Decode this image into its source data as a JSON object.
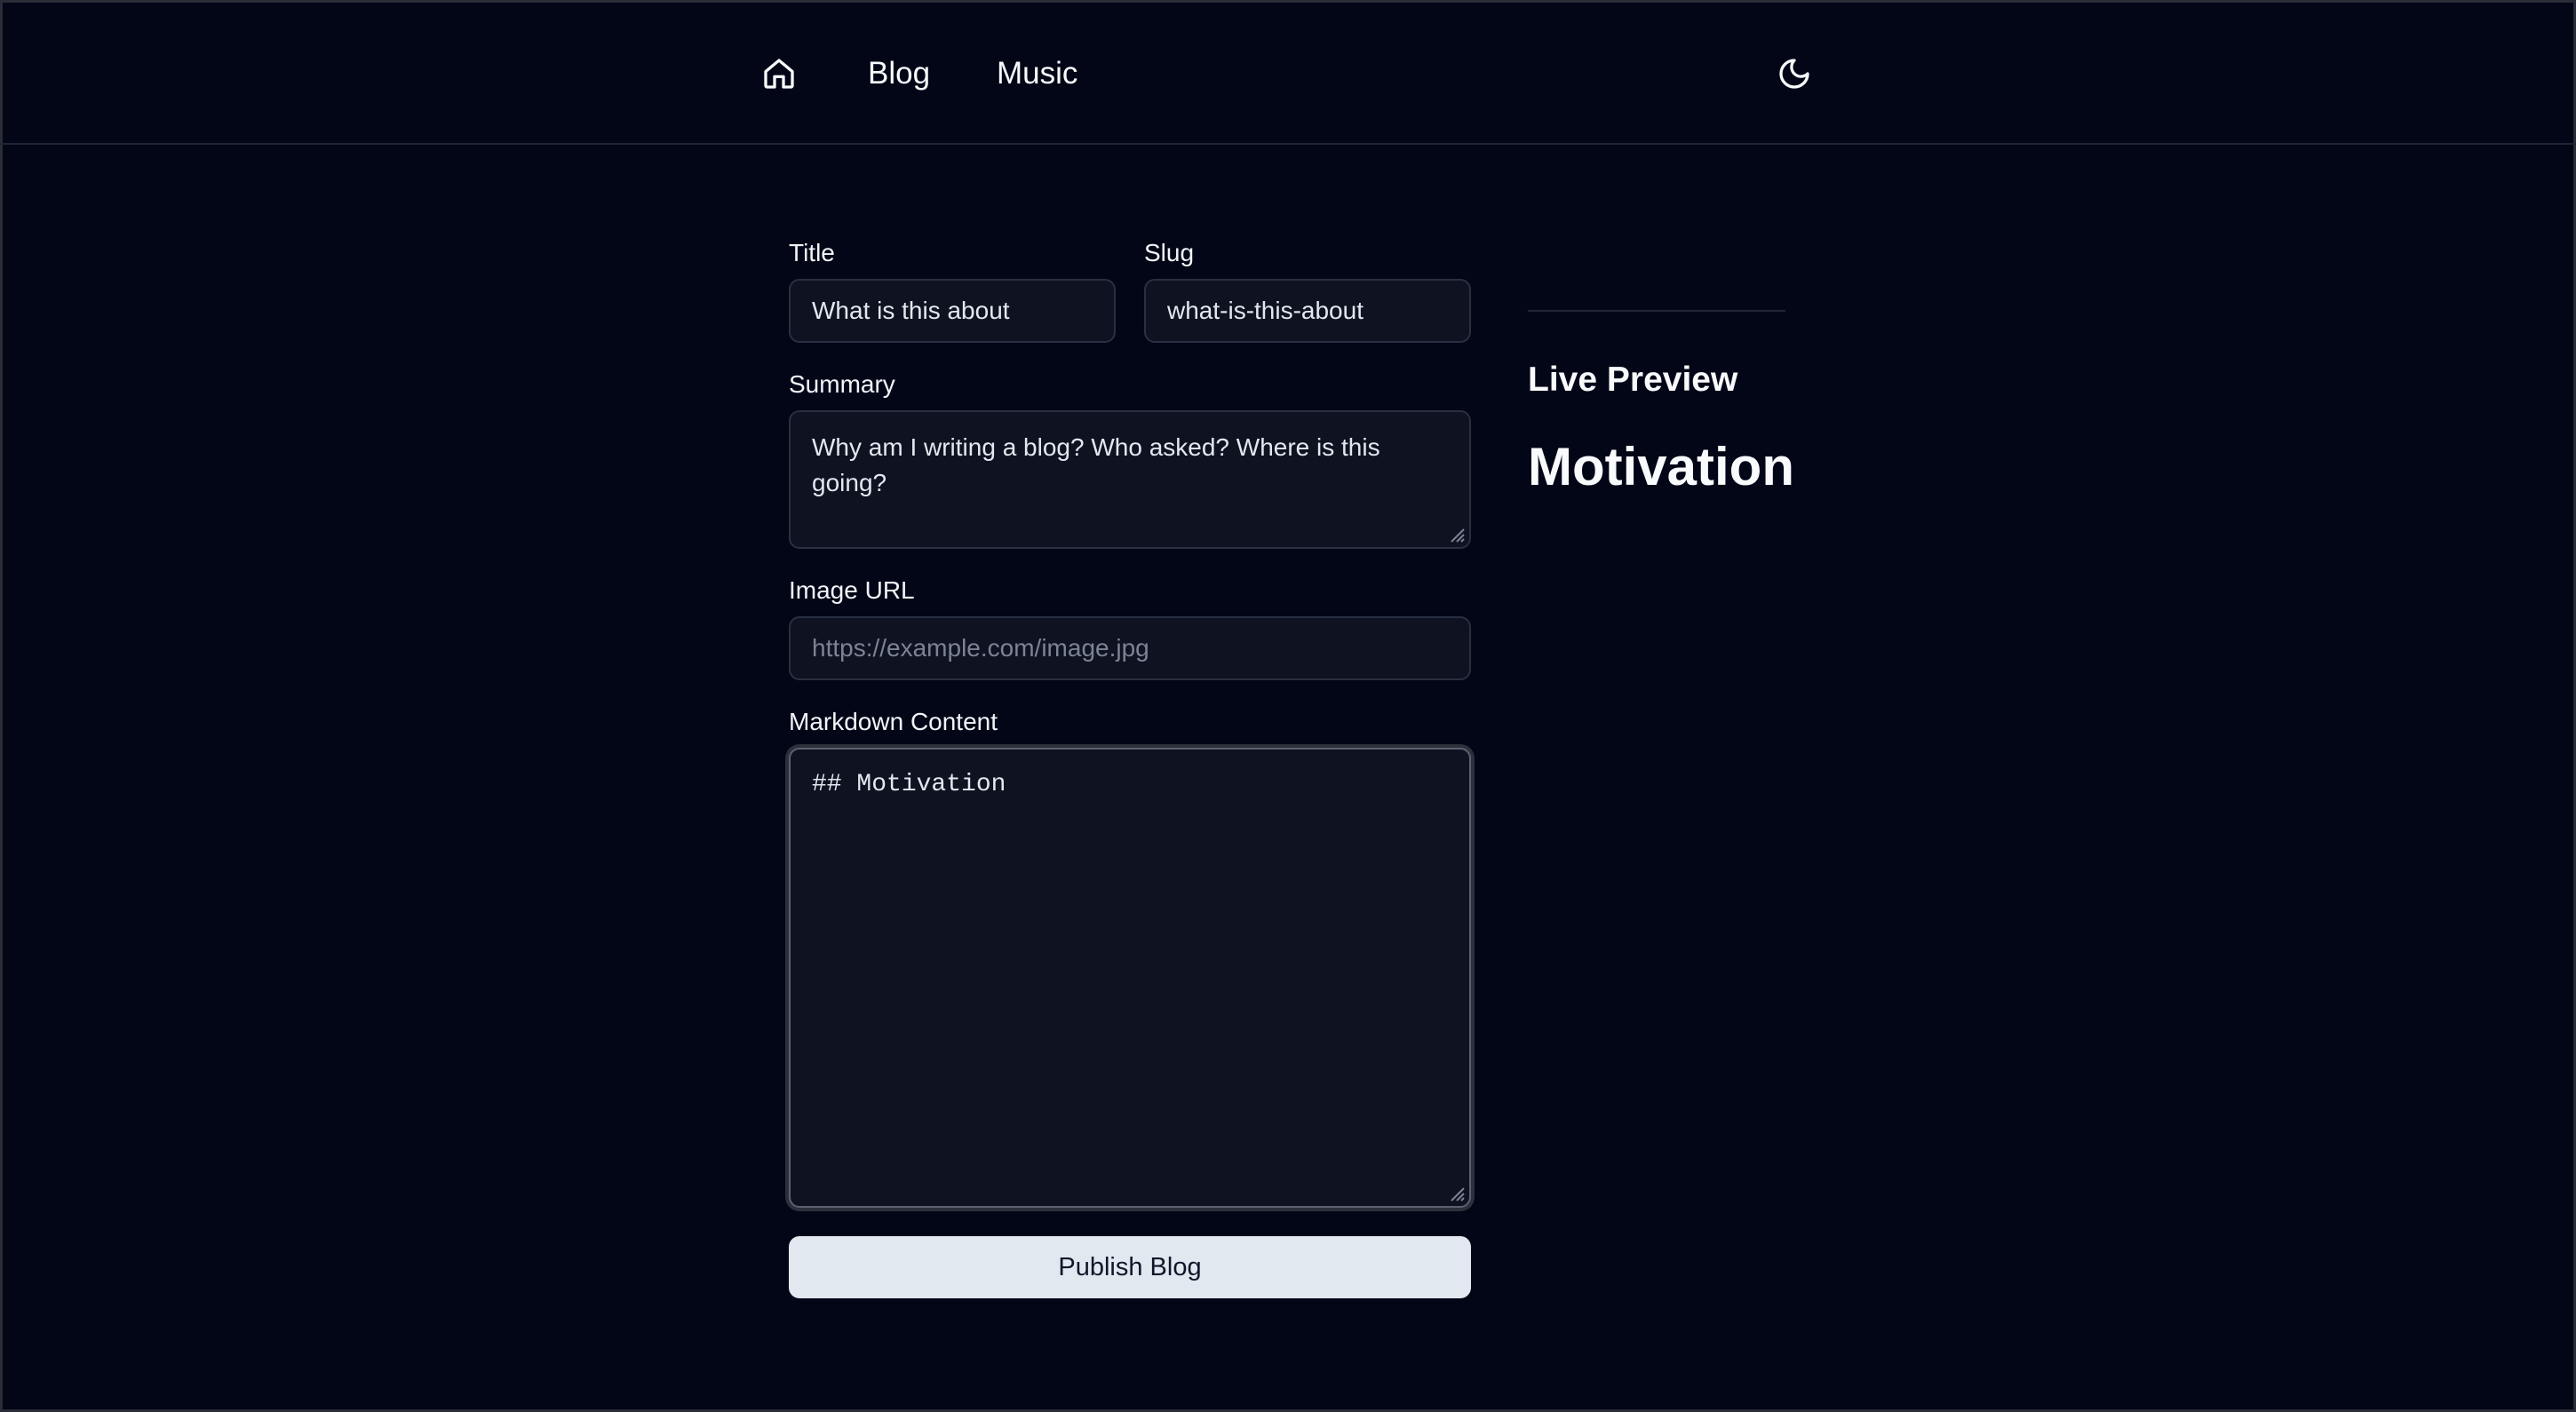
{
  "nav": {
    "home_icon": "home-icon",
    "blog_label": "Blog",
    "music_label": "Music",
    "theme_icon": "moon-icon"
  },
  "form": {
    "title": {
      "label": "Title",
      "value": "What is this about"
    },
    "slug": {
      "label": "Slug",
      "value": "what-is-this-about"
    },
    "summary": {
      "label": "Summary",
      "value": "Why am I writing a blog? Who asked? Where is this going?"
    },
    "image_url": {
      "label": "Image URL",
      "value": "",
      "placeholder": "https://example.com/image.jpg"
    },
    "markdown": {
      "label": "Markdown Content",
      "value": "## Motivation\n\n"
    },
    "publish_label": "Publish Blog"
  },
  "preview": {
    "heading": "Live Preview",
    "title": "Motivation"
  },
  "colors": {
    "background": "#020617",
    "field_background": "#0f1220",
    "button_background": "#e2e8f0"
  }
}
